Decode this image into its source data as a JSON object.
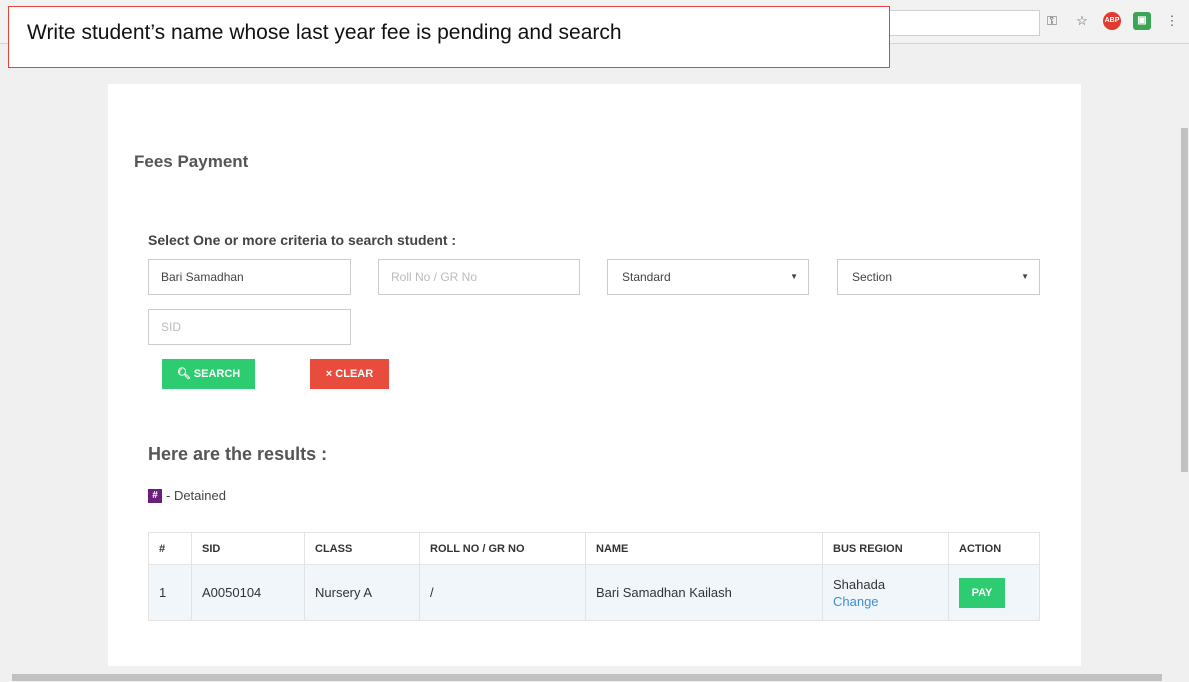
{
  "annotation": {
    "text": "Write student’s name whose last year fee is pending and search"
  },
  "browser": {
    "icons": [
      "key-icon",
      "star-icon",
      "adblock-icon",
      "extension-icon",
      "menu-icon"
    ],
    "abp_label": "ABP"
  },
  "page": {
    "title": "Fees Payment",
    "criteria_label": "Select One or more criteria to search student :",
    "name_input": {
      "value": "Bari Samadhan",
      "placeholder": ""
    },
    "roll_input": {
      "value": "",
      "placeholder": "Roll No / GR No"
    },
    "standard_select": {
      "value": "Standard"
    },
    "section_select": {
      "value": "Section"
    },
    "sid_input": {
      "value": "",
      "placeholder": "SID"
    },
    "search_button": "SEARCH",
    "clear_button": "CLEAR",
    "results_heading": "Here are the results :",
    "legend": {
      "badge": "#",
      "text": "- Detained"
    }
  },
  "table": {
    "headers": [
      "#",
      "SID",
      "CLASS",
      "ROLL NO / GR NO",
      "NAME",
      "BUS REGION",
      "ACTION"
    ],
    "rows": [
      {
        "index": "1",
        "sid": "A0050104",
        "class": "Nursery A",
        "roll": "/",
        "name": "Bari Samadhan Kailash",
        "bus_region": "Shahada",
        "bus_change": "Change",
        "action": "PAY"
      }
    ]
  },
  "colors": {
    "accent_green": "#2ecc71",
    "accent_red": "#e74c3c",
    "detained_purple": "#6b1f7a",
    "link_blue": "#3b8fd6"
  }
}
